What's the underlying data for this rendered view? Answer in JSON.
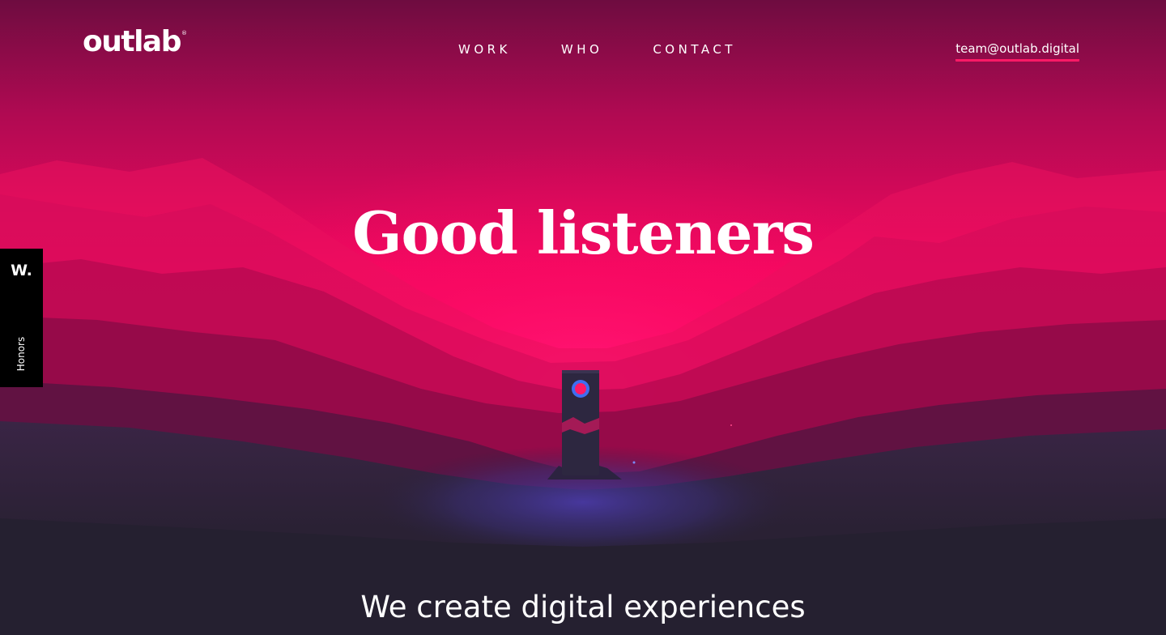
{
  "brand": {
    "logo_text": "outlab",
    "logo_mark": "®"
  },
  "nav": {
    "work": "WORK",
    "who": "WHO",
    "contact": "CONTACT"
  },
  "contact": {
    "email": "team@outlab.digital"
  },
  "hero": {
    "headline": "Good listeners",
    "subline": "We create digital experiences"
  },
  "honors_badge": {
    "mark": "W.",
    "label": "Honors"
  },
  "colors": {
    "accent": "#ff1a66",
    "sky_top": "#7a0a45",
    "glow": "#ff0a6a",
    "ground": "#26202e"
  }
}
